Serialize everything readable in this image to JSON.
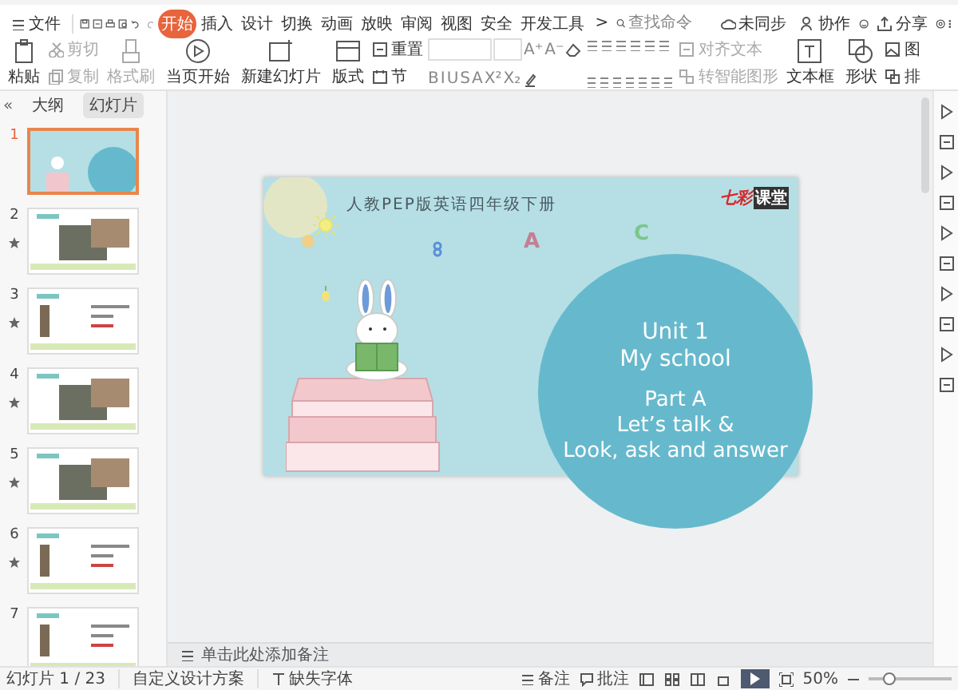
{
  "menu": {
    "file": "文件",
    "tabs": [
      {
        "label": "开始",
        "selected": true
      },
      {
        "label": "插入",
        "selected": false
      },
      {
        "label": "设计",
        "selected": false
      },
      {
        "label": "切换",
        "selected": false
      },
      {
        "label": "动画",
        "selected": false
      },
      {
        "label": "放映",
        "selected": false
      },
      {
        "label": "审阅",
        "selected": false
      },
      {
        "label": "视图",
        "selected": false
      },
      {
        "label": "安全",
        "selected": false
      },
      {
        "label": "开发工具",
        "selected": false
      }
    ],
    "more": ">",
    "search": {
      "placeholder": "查找命令"
    },
    "actions": [
      "未同步",
      "协作",
      "分享"
    ]
  },
  "ribbon": [
    {
      "kind": "large",
      "label": "粘贴",
      "disabled": false
    },
    {
      "kind": "stack",
      "items": [
        {
          "label": "剪切",
          "disabled": true
        },
        {
          "label": "复制",
          "disabled": true
        }
      ]
    },
    {
      "kind": "large",
      "label": "格式刷",
      "disabled": true
    },
    {
      "kind": "large",
      "label": "当页开始",
      "disabled": false
    },
    {
      "kind": "large",
      "label": "新建幻灯片",
      "disabled": false
    },
    {
      "kind": "large",
      "label": "版式",
      "disabled": false
    },
    {
      "kind": "stack",
      "items": [
        {
          "label": "重置",
          "disabled": false
        },
        {
          "label": "节",
          "disabled": false
        }
      ]
    },
    {
      "kind": "font",
      "row1": [
        "A⁺",
        "A⁻"
      ],
      "row2": [
        "B",
        "I",
        "U",
        "S",
        "A",
        "X²",
        "X₂"
      ]
    },
    {
      "kind": "paragraph"
    },
    {
      "kind": "stack",
      "items": [
        {
          "label": "对齐文本",
          "disabled": true
        },
        {
          "label": "转智能图形",
          "disabled": true
        }
      ]
    },
    {
      "kind": "large",
      "label": "文本框",
      "disabled": false
    },
    {
      "kind": "large",
      "label": "形状",
      "disabled": false
    },
    {
      "kind": "stack",
      "items": [
        {
          "label": "图",
          "disabled": false
        },
        {
          "label": "排",
          "disabled": false
        }
      ]
    }
  ],
  "panel": {
    "collapse": "«",
    "tabs": [
      {
        "label": "大纲",
        "selected": false
      },
      {
        "label": "幻灯片",
        "selected": true
      }
    ],
    "slides": [
      {
        "number": "1",
        "kind": "title",
        "animated": false,
        "selected": true
      },
      {
        "number": "2",
        "kind": "photo",
        "animated": true,
        "selected": false
      },
      {
        "number": "3",
        "kind": "list",
        "animated": true,
        "selected": false
      },
      {
        "number": "4",
        "kind": "photo",
        "animated": true,
        "selected": false
      },
      {
        "number": "5",
        "kind": "photo",
        "animated": true,
        "selected": false
      },
      {
        "number": "6",
        "kind": "list",
        "animated": true,
        "selected": false
      },
      {
        "number": "7",
        "kind": "list",
        "animated": false,
        "selected": false
      }
    ]
  },
  "slide": {
    "header": "人教PEP版英语四年级下册",
    "logo": [
      "七彩",
      "课堂"
    ],
    "letters": [
      "A",
      "C"
    ],
    "lines": [
      "Unit 1",
      "My school",
      "Part A",
      "Let’s talk &",
      "Look, ask and answer"
    ]
  },
  "notes": {
    "placeholder": "单击此处添加备注"
  },
  "status_bar": {
    "slide_count": "幻灯片 1 / 23",
    "theme": "自定义设计方案",
    "missing_fonts": "缺失字体",
    "notes": "备注",
    "comments": "批注",
    "zoom": "50%",
    "zoom_slider": {
      "level": 0.25
    }
  }
}
